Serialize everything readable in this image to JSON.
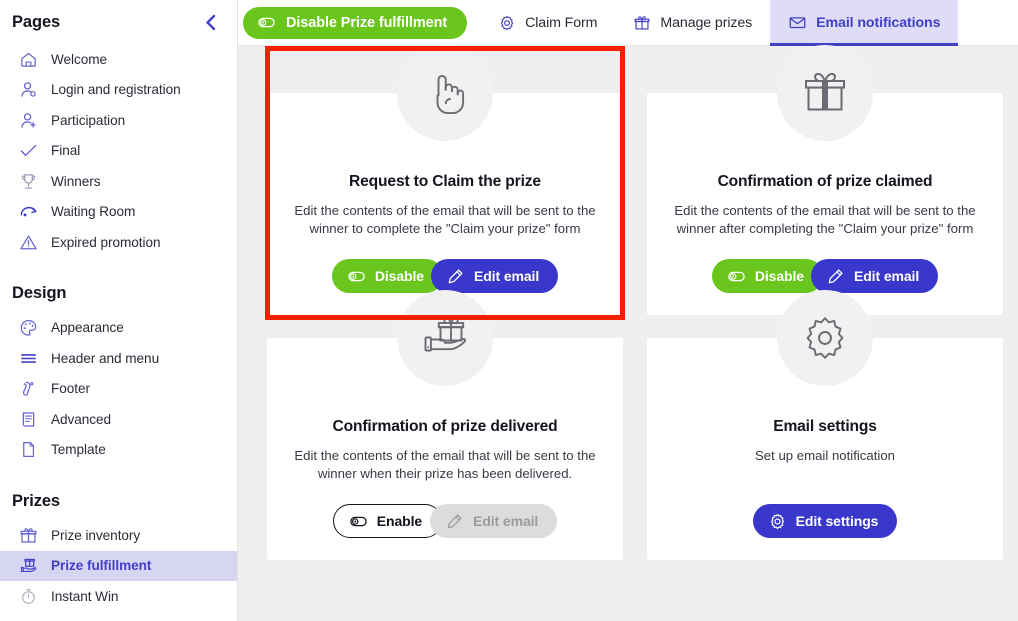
{
  "sidebar": {
    "sections": [
      {
        "title": "Pages",
        "collapse_icon": "chevron-left-icon",
        "items": [
          {
            "label": "Welcome",
            "icon": "home-icon",
            "active": false
          },
          {
            "label": "Login and registration",
            "icon": "user-login-icon",
            "active": false
          },
          {
            "label": "Participation",
            "icon": "user-add-icon",
            "active": false
          },
          {
            "label": "Final",
            "icon": "check-icon",
            "active": false
          },
          {
            "label": "Winners",
            "icon": "trophy-icon",
            "active": false
          },
          {
            "label": "Waiting Room",
            "icon": "waiting-room-icon",
            "active": false
          },
          {
            "label": "Expired promotion",
            "icon": "warning-triangle-icon",
            "active": false
          }
        ]
      },
      {
        "title": "Design",
        "items": [
          {
            "label": "Appearance",
            "icon": "palette-icon",
            "active": false
          },
          {
            "label": "Header and menu",
            "icon": "menu-lines-icon",
            "active": false
          },
          {
            "label": "Footer",
            "icon": "footer-icon",
            "active": false
          },
          {
            "label": "Advanced",
            "icon": "document-code-icon",
            "active": false
          },
          {
            "label": "Template",
            "icon": "page-icon",
            "active": false
          }
        ]
      },
      {
        "title": "Prizes",
        "items": [
          {
            "label": "Prize inventory",
            "icon": "gift-icon",
            "active": false
          },
          {
            "label": "Prize fulfillment",
            "icon": "gift-hand-icon",
            "active": true
          },
          {
            "label": "Instant Win",
            "icon": "stopwatch-icon",
            "active": false
          }
        ]
      }
    ]
  },
  "topbar": {
    "primary_button": {
      "label": "Disable Prize fulfillment",
      "icon": "toggle-on-icon",
      "color": "#6ac61c"
    },
    "tabs": [
      {
        "label": "Claim Form",
        "icon": "gear-icon",
        "active": false
      },
      {
        "label": "Manage prizes",
        "icon": "gift-icon",
        "active": false
      },
      {
        "label": "Email notifications",
        "icon": "envelope-icon",
        "active": true
      }
    ]
  },
  "cards": [
    {
      "title": "Request to Claim the prize",
      "description": "Edit the contents of the email that will be sent to the winner to complete the \"Claim your prize\" form",
      "icon": "hand-pointing-icon",
      "highlighted": true,
      "buttons": [
        {
          "label": "Disable",
          "icon": "toggle-on-icon",
          "style": "green"
        },
        {
          "label": "Edit email",
          "icon": "pencil-icon",
          "style": "blue"
        }
      ]
    },
    {
      "title": "Confirmation of prize claimed",
      "description": "Edit the contents of the email that will be sent to the winner after completing the \"Claim your prize\" form",
      "icon": "gift-box-icon",
      "highlighted": false,
      "buttons": [
        {
          "label": "Disable",
          "icon": "toggle-on-icon",
          "style": "green"
        },
        {
          "label": "Edit email",
          "icon": "pencil-icon",
          "style": "blue"
        }
      ]
    },
    {
      "title": "Confirmation of prize delivered",
      "description": "Edit the contents of the email that will be sent to the winner when their prize has been delivered.",
      "icon": "gift-hand-icon",
      "highlighted": false,
      "buttons": [
        {
          "label": "Enable",
          "icon": "toggle-off-icon",
          "style": "outline"
        },
        {
          "label": "Edit email",
          "icon": "pencil-icon",
          "style": "disabled"
        }
      ]
    },
    {
      "title": "Email settings",
      "description": "Set up email notification",
      "icon": "gear-icon",
      "highlighted": false,
      "buttons": [
        {
          "label": "Edit settings",
          "icon": "gear-icon",
          "style": "blue-solo"
        }
      ]
    }
  ],
  "colors": {
    "accent_indigo": "#3a38cc",
    "accent_green": "#6ac61c",
    "highlight_red": "#f52000",
    "sidebar_active_bg": "#d7d6f2",
    "page_bg": "#efefef"
  }
}
